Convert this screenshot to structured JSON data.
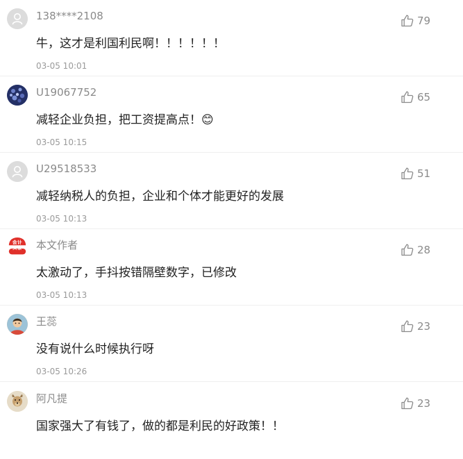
{
  "comments": [
    {
      "username": "138****2108",
      "text": "牛，这才是利国利民啊！！！！！！",
      "time": "03-05 10:01",
      "likes": "79",
      "avatar": "default-avatar-icon"
    },
    {
      "username": "U19067752",
      "text": "减轻企业负担，把工资提高点！😊",
      "time": "03-05 10:15",
      "likes": "65",
      "avatar": "blue-pattern-avatar"
    },
    {
      "username": "U29518533",
      "text": "减轻纳税人的负担，企业和个体才能更好的发展",
      "time": "03-05 10:13",
      "likes": "51",
      "avatar": "default-avatar-icon"
    },
    {
      "username": "本文作者",
      "text": "太激动了，手抖按错隔壁数字，已修改",
      "time": "03-05 10:13",
      "likes": "28",
      "avatar": "author-logo",
      "avatar_text": "会计头条"
    },
    {
      "username": "王蕊",
      "text": "没有说什么时候执行呀",
      "time": "03-05 10:26",
      "likes": "23",
      "avatar": "child-photo-avatar"
    },
    {
      "username": "阿凡提",
      "text": "国家强大了有钱了，做的都是利民的好政策！！",
      "time": "",
      "likes": "23",
      "avatar": "dog-photo-avatar"
    }
  ],
  "colors": {
    "username": "#8a8a8a",
    "content": "#222222",
    "time": "#9a9a9a",
    "divider": "#efefef",
    "author_logo_red": "#e0302a"
  }
}
